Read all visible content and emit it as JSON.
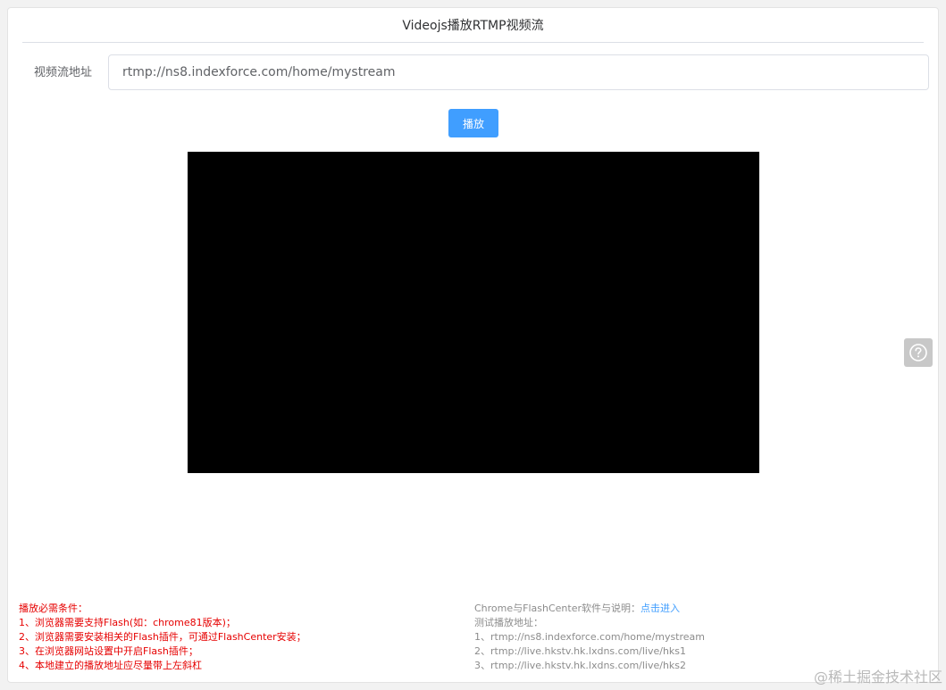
{
  "page": {
    "title": "Videojs播放RTMP视频流"
  },
  "form": {
    "url_label": "视频流地址",
    "url_value": "rtmp://ns8.indexforce.com/home/mystream",
    "play_label": "播放"
  },
  "requirements": {
    "heading": "播放必需条件：",
    "items": [
      "1、浏览器需要支持Flash(如：chrome81版本)；",
      "2、浏览器需要安装相关的Flash插件，可通过FlashCenter安装；",
      "3、在浏览器网站设置中开启Flash插件；",
      "4、本地建立的播放地址应尽量带上左斜杠"
    ]
  },
  "info": {
    "software_text": "Chrome与FlashCenter软件与说明：",
    "software_link": "点击进入",
    "test_heading": "测试播放地址：",
    "test_urls": [
      "1、rtmp://ns8.indexforce.com/home/mystream",
      "2、rtmp://live.hkstv.hk.lxdns.com/live/hks1",
      "3、rtmp://live.hkstv.hk.lxdns.com/live/hks2"
    ]
  },
  "watermark": "@稀土掘金技术社区",
  "icons": {
    "help": "question-circle-icon"
  },
  "colors": {
    "accent": "#409eff",
    "warning_text": "#e60000",
    "video_bg": "#000000"
  }
}
